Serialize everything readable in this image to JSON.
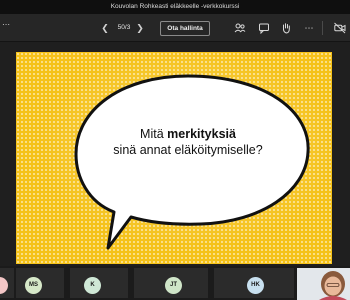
{
  "window": {
    "title": "Kouvolan Rohkeasti eläkkeelle -verkkokurssi"
  },
  "toolbar": {
    "more_icon": "more-dots-icon",
    "page_counter": "50/3",
    "take_control_label": "Ota hallinta",
    "icons": [
      "people-icon",
      "chat-icon",
      "raise-hand-icon",
      "more-icon",
      "camera-icon"
    ]
  },
  "slide": {
    "line1_prefix": "Mitä ",
    "line1_bold": "merkityksiä",
    "line2": "sinä annat eläköitymiselle?",
    "colors": {
      "background": "#f5c21a",
      "bubble": "#ffffff",
      "outline": "#111111"
    }
  },
  "participants": [
    {
      "initials": "MS",
      "color": "#d6e8c8"
    },
    {
      "initials": "K",
      "color": "#cfe8d6"
    },
    {
      "initials": "JT",
      "color": "#cfe5c8"
    },
    {
      "initials": "HK",
      "color": "#c8e0ef"
    }
  ]
}
